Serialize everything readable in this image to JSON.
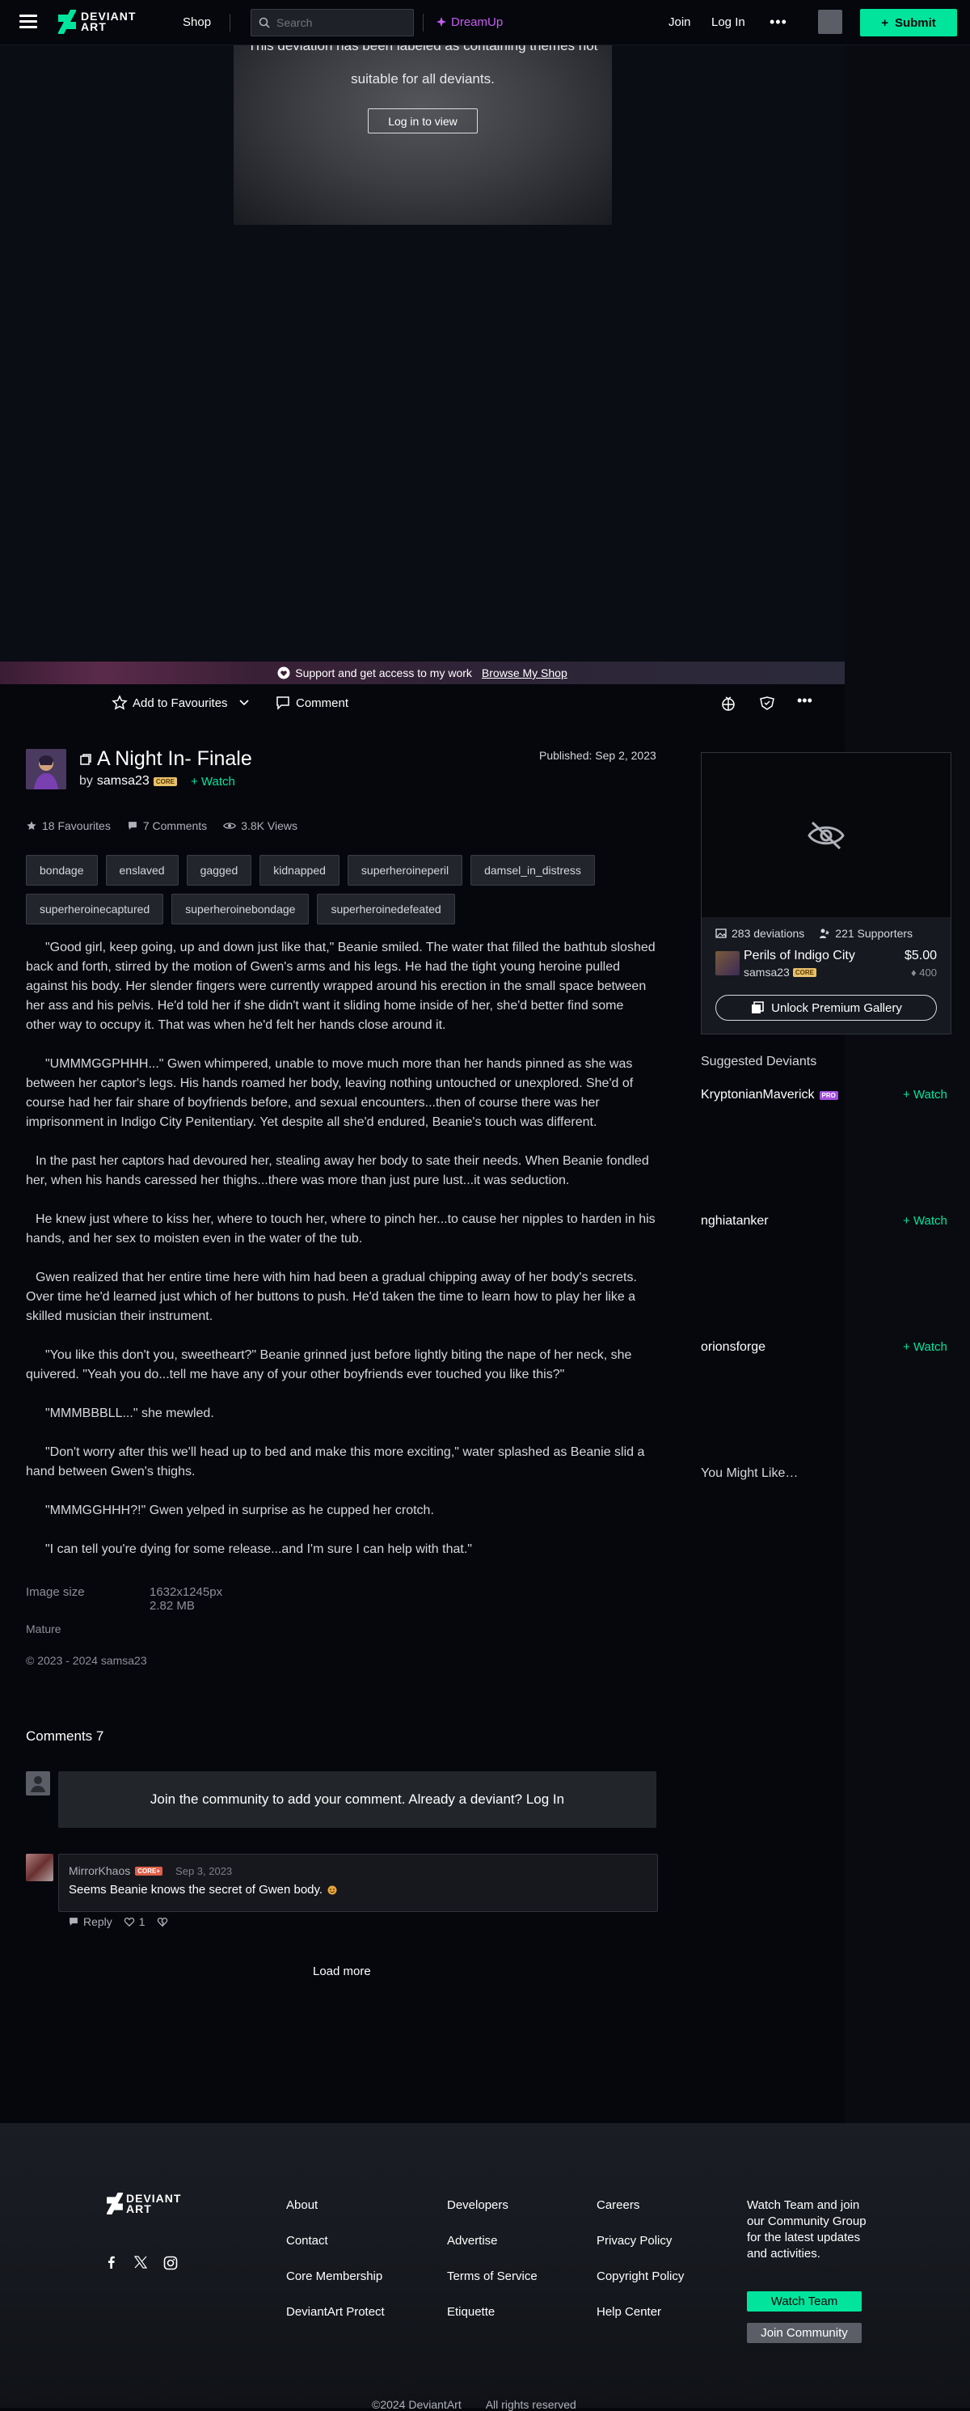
{
  "nav": {
    "logo_text_1": "DEVIANT",
    "logo_text_2": "ART",
    "shop": "Shop",
    "search_placeholder": "Search",
    "dreamup": "DreamUp",
    "join": "Join",
    "login": "Log In",
    "more": "•••",
    "submit": "Submit"
  },
  "hero": {
    "mature_line1": "This deviation has been labeled as containing themes not",
    "mature_line2": "suitable for all deviants.",
    "login_to_view": "Log in to view"
  },
  "support_banner": {
    "text": "Support and get access to my work",
    "link": "Browse My Shop"
  },
  "actions": {
    "add_favourites": "Add to Favourites",
    "comment": "Comment"
  },
  "deviation": {
    "title": "A Night In- Finale",
    "by": "by",
    "author": "samsa23",
    "core_badge": "CORE",
    "watch": "Watch",
    "published": "Published: Sep 2, 2023",
    "favourites": "18 Favourites",
    "comments": "7 Comments",
    "views": "3.8K Views",
    "tags": [
      "bondage",
      "enslaved",
      "gagged",
      "kidnapped",
      "superheroineperil",
      "damsel_in_distress",
      "superheroinecaptured",
      "superheroinebondage",
      "superheroinedefeated"
    ],
    "story": [
      "\"Good girl, keep going, up and down just like that,\" Beanie smiled. The water that filled the bathtub sloshed back and forth, stirred by the motion of Gwen's arms and his legs. He had the tight young heroine pulled against his body. Her slender fingers were currently wrapped around his erection in the small space between her ass and his pelvis. He'd told her if she didn't want it sliding home inside of her, she'd better find some other way to occupy it. That was when he'd felt her hands close around it.",
      "\"UMMMGGPHHH...\" Gwen whimpered, unable to move much more than her hands pinned as she was between her captor's legs. His hands roamed her body, leaving nothing untouched or unexplored. She'd of course had her fair share of boyfriends before, and sexual encounters...then of course there was her imprisonment in Indigo City Penitentiary. Yet despite all she'd endured, Beanie's touch was different.",
      "In the past her captors had devoured her, stealing away her body to sate their needs. When Beanie fondled her, when his hands caressed her thighs...there was more than just pure lust...it was seduction.",
      "He knew just where to kiss her, where to touch her, where to pinch her...to cause her nipples to harden in his hands, and her sex to moisten even in the water of the tub.",
      "Gwen realized that her entire time here with him had been a gradual chipping away of her body's secrets. Over time he'd learned just which of her buttons to push. He'd taken the time to learn how to play her like a skilled musician their instrument.",
      "\"You like this don't you, sweetheart?\" Beanie grinned just before lightly biting the nape of her neck, she quivered. \"Yeah you do...tell me have any of your other boyfriends ever touched you like this?\"",
      "\"MMMBBBLL...\" she mewled.",
      "\"Don't worry after this we'll head up to bed and make this more exciting,\" water splashed as Beanie slid a hand between Gwen's thighs.",
      "\"MMMGGHHH?!\" Gwen yelped in surprise as he cupped her crotch.",
      "\"I can tell you're dying for some release...and I'm sure I can help with that.\""
    ],
    "image_size_label": "Image size",
    "image_size_value": "1632x1245px 2.82 MB",
    "mature": "Mature",
    "copyright": "© 2023 - 2024 samsa23"
  },
  "premium": {
    "deviations": "283 deviations",
    "supporters": "221 Supporters",
    "gallery_title": "Perils of Indigo City",
    "author": "samsa23",
    "core_badge": "CORE",
    "price": "$5.00",
    "points": "400",
    "unlock": "Unlock Premium Gallery"
  },
  "sidebar": {
    "suggested_heading": "Suggested Deviants",
    "suggested": [
      {
        "name": "KryptonianMaverick",
        "badge": "PRO",
        "watch": "Watch"
      },
      {
        "name": "nghiatanker",
        "badge": "",
        "watch": "Watch"
      },
      {
        "name": "orionsforge",
        "badge": "",
        "watch": "Watch"
      }
    ],
    "you_might_like": "You Might Like…"
  },
  "comments": {
    "heading": "Comments 7",
    "join_prompt": "Join the community to add your comment. Already a deviant? Log In",
    "items": [
      {
        "user": "MirrorKhaos",
        "badge": "CORE+",
        "date": "Sep 3, 2023",
        "text": "Seems Beanie knows the secret of Gwen body.",
        "reply": "Reply",
        "likes": "1"
      }
    ],
    "load_more": "Load more"
  },
  "footer": {
    "logo_text_1": "DEVIANT",
    "logo_text_2": "ART",
    "col1": [
      "About",
      "Contact",
      "Core Membership",
      "DeviantArt Protect"
    ],
    "col2": [
      "Developers",
      "Advertise",
      "Terms of Service",
      "Etiquette"
    ],
    "col3": [
      "Careers",
      "Privacy Policy",
      "Copyright Policy",
      "Help Center"
    ],
    "cta": "Watch Team and join our Community Group for the latest updates and activities.",
    "watch_team": "Watch Team",
    "join_community": "Join Community",
    "copyright": "©2024 DeviantArt",
    "rights": "All rights reserved"
  },
  "colors": {
    "accent": "#00e59b",
    "background": "#06070d",
    "dreamup": "#c45ff0",
    "core_badge": "#e8c16b"
  }
}
